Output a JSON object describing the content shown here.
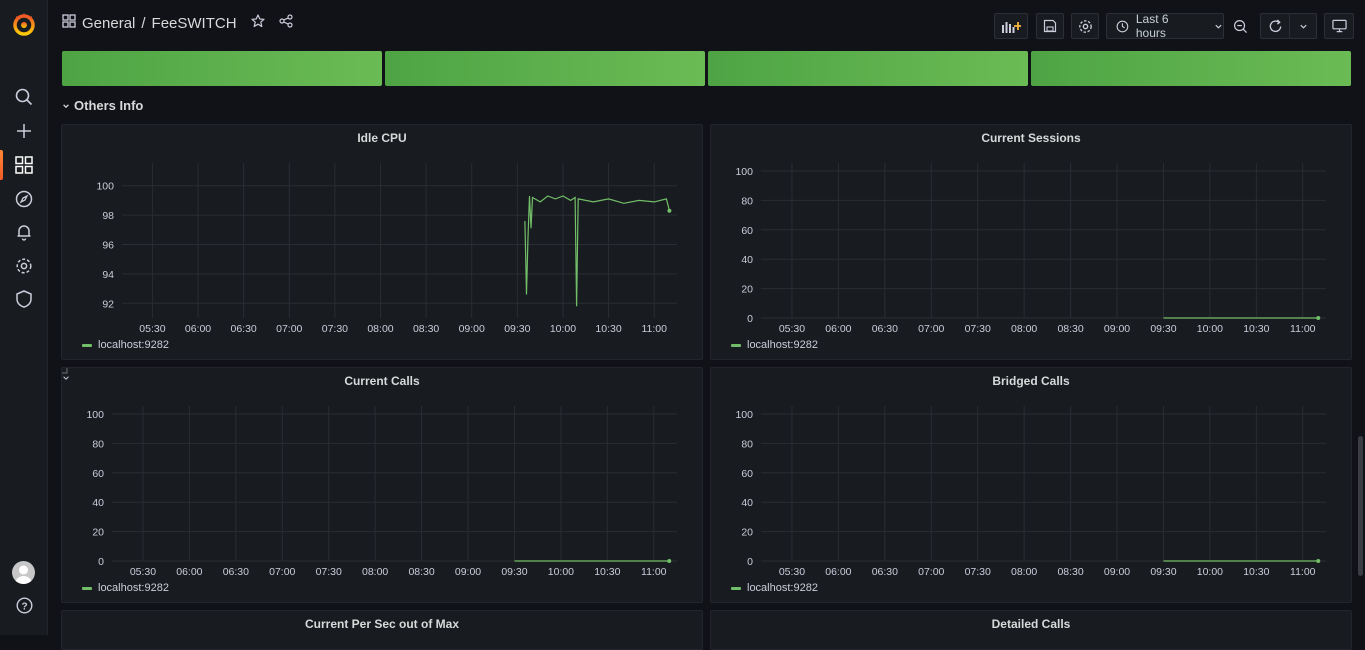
{
  "header": {
    "folder": "General",
    "separator": "/",
    "dashboard": "FeeSWITCH",
    "time_range": "Last 6 hours"
  },
  "row": {
    "title": "Others Info"
  },
  "colors": {
    "accent": "#f05a28",
    "series": "#73bf69",
    "stat": "#5aaf4c"
  },
  "panels": [
    {
      "title": "Idle CPU",
      "legend": "localhost:9282"
    },
    {
      "title": "Current Sessions",
      "legend": "localhost:9282"
    },
    {
      "title": "Current Calls",
      "legend": "localhost:9282"
    },
    {
      "title": "Bridged Calls",
      "legend": "localhost:9282"
    },
    {
      "title": "Current Per Sec out of Max"
    },
    {
      "title": "Detailed Calls"
    }
  ],
  "chart_data": [
    {
      "type": "line",
      "title": "Idle CPU",
      "x_ticks": [
        "05:30",
        "06:00",
        "06:30",
        "07:00",
        "07:30",
        "08:00",
        "08:30",
        "09:00",
        "09:30",
        "10:00",
        "10:30",
        "11:00"
      ],
      "y_ticks": [
        92,
        94,
        96,
        98,
        100
      ],
      "ylim": [
        91,
        101
      ],
      "series": [
        {
          "name": "localhost:9282",
          "points": [
            [
              "09:35",
              97.6
            ],
            [
              "09:36",
              92.6
            ],
            [
              "09:37",
              96.5
            ],
            [
              "09:38",
              99.3
            ],
            [
              "09:39",
              97.1
            ],
            [
              "09:40",
              99.2
            ],
            [
              "09:45",
              98.9
            ],
            [
              "09:50",
              99.3
            ],
            [
              "09:55",
              99.1
            ],
            [
              "10:00",
              99.3
            ],
            [
              "10:05",
              99.0
            ],
            [
              "10:08",
              99.2
            ],
            [
              "10:09",
              91.8
            ],
            [
              "10:10",
              99.1
            ],
            [
              "10:20",
              98.9
            ],
            [
              "10:30",
              99.1
            ],
            [
              "10:40",
              98.8
            ],
            [
              "10:50",
              99.0
            ],
            [
              "11:00",
              98.9
            ],
            [
              "11:08",
              99.1
            ],
            [
              "11:10",
              98.3
            ]
          ]
        }
      ]
    },
    {
      "type": "line",
      "title": "Current Sessions",
      "x_ticks": [
        "05:30",
        "06:00",
        "06:30",
        "07:00",
        "07:30",
        "08:00",
        "08:30",
        "09:00",
        "09:30",
        "10:00",
        "10:30",
        "11:00"
      ],
      "y_ticks": [
        0,
        20,
        40,
        60,
        80,
        100
      ],
      "ylim": [
        0,
        100
      ],
      "series": [
        {
          "name": "localhost:9282",
          "points": [
            [
              "09:30",
              0
            ],
            [
              "11:10",
              0
            ]
          ]
        }
      ]
    },
    {
      "type": "line",
      "title": "Current Calls",
      "x_ticks": [
        "05:30",
        "06:00",
        "06:30",
        "07:00",
        "07:30",
        "08:00",
        "08:30",
        "09:00",
        "09:30",
        "10:00",
        "10:30",
        "11:00"
      ],
      "y_ticks": [
        0,
        20,
        40,
        60,
        80,
        100
      ],
      "ylim": [
        0,
        100
      ],
      "series": [
        {
          "name": "localhost:9282",
          "points": [
            [
              "09:30",
              0
            ],
            [
              "11:10",
              0
            ]
          ]
        }
      ]
    },
    {
      "type": "line",
      "title": "Bridged Calls",
      "x_ticks": [
        "05:30",
        "06:00",
        "06:30",
        "07:00",
        "07:30",
        "08:00",
        "08:30",
        "09:00",
        "09:30",
        "10:00",
        "10:30",
        "11:00"
      ],
      "y_ticks": [
        0,
        20,
        40,
        60,
        80,
        100
      ],
      "ylim": [
        0,
        100
      ],
      "series": [
        {
          "name": "localhost:9282",
          "points": [
            [
              "09:30",
              0
            ],
            [
              "11:10",
              0
            ]
          ]
        }
      ]
    }
  ]
}
